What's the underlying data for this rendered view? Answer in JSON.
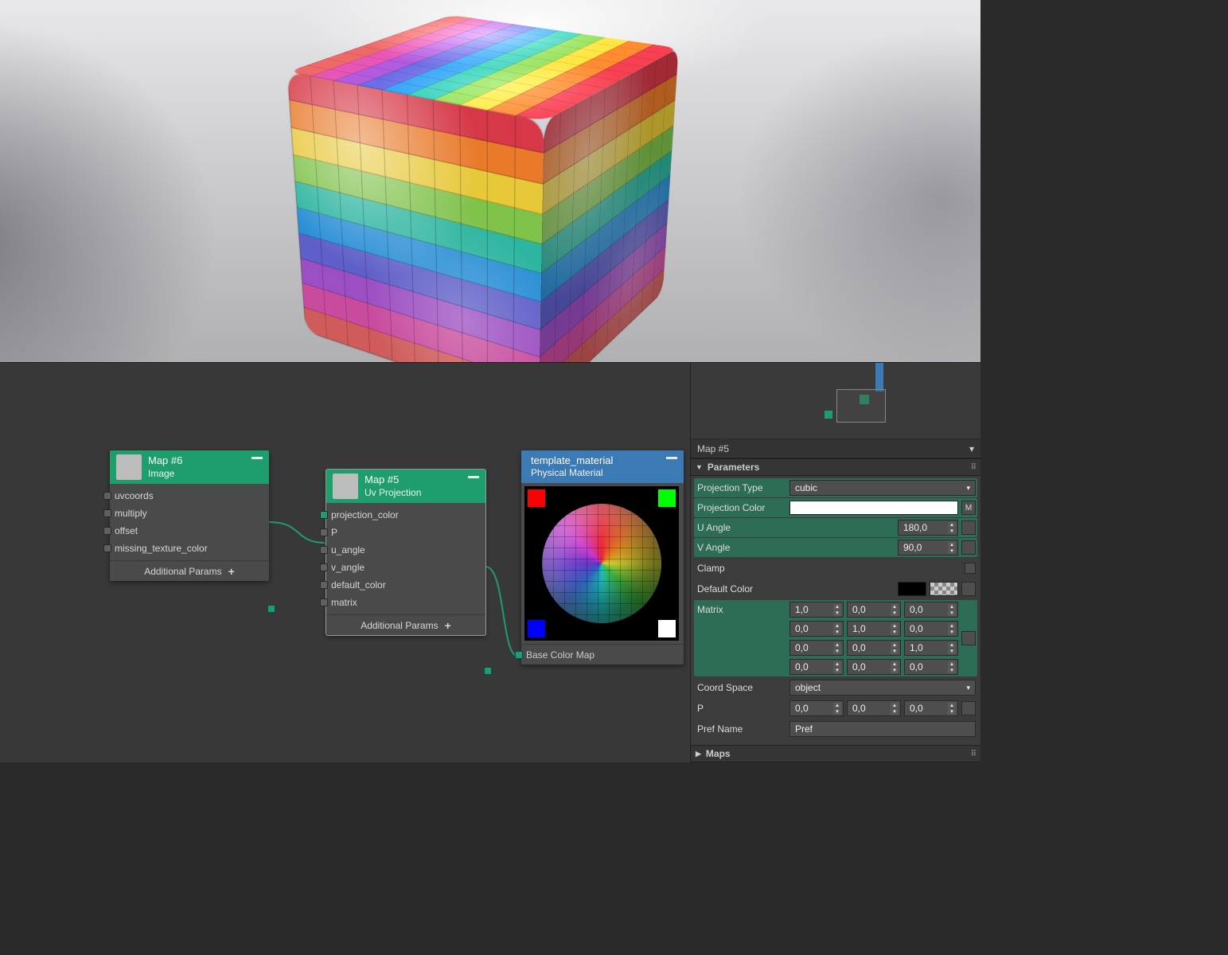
{
  "viewport": {
    "object": "rounded_cube_with_uv_checker"
  },
  "nodes": {
    "image": {
      "title": "Map #6",
      "subtitle": "Image",
      "params": [
        "uvcoords",
        "multiply",
        "offset",
        "missing_texture_color"
      ],
      "additional": "Additional Params"
    },
    "uvproj": {
      "title": "Map #5",
      "subtitle": "Uv Projection",
      "params": [
        "projection_color",
        "P",
        "u_angle",
        "v_angle",
        "default_color",
        "matrix"
      ],
      "additional": "Additional Params"
    },
    "material": {
      "title": "template_material",
      "subtitle": "Physical Material",
      "slot": "Base Color Map"
    }
  },
  "panel": {
    "selector": "Map #5",
    "rollouts": {
      "parameters": "Parameters",
      "maps": "Maps"
    },
    "params": {
      "projection_type": {
        "label": "Projection Type",
        "value": "cubic"
      },
      "projection_color": {
        "label": "Projection Color",
        "btn": "M"
      },
      "u_angle": {
        "label": "U Angle",
        "value": "180,0"
      },
      "v_angle": {
        "label": "V Angle",
        "value": "90,0"
      },
      "clamp": {
        "label": "Clamp"
      },
      "default_color": {
        "label": "Default Color"
      },
      "matrix": {
        "label": "Matrix",
        "rows": [
          [
            "1,0",
            "0,0",
            "0,0"
          ],
          [
            "0,0",
            "1,0",
            "0,0"
          ],
          [
            "0,0",
            "0,0",
            "1,0"
          ],
          [
            "0,0",
            "0,0",
            "0,0"
          ]
        ]
      },
      "coord_space": {
        "label": "Coord Space",
        "value": "object"
      },
      "p": {
        "label": "P",
        "values": [
          "0,0",
          "0,0",
          "0,0"
        ]
      },
      "pref_name": {
        "label": "Pref Name",
        "value": "Pref"
      }
    }
  },
  "colors": {
    "stripes": [
      "#d73847",
      "#e97a2a",
      "#e7c838",
      "#7fc24a",
      "#2cb5a0",
      "#2b8fd6",
      "#5f5fc9",
      "#9c4fc2",
      "#c94b9e",
      "#d05b5b"
    ]
  }
}
